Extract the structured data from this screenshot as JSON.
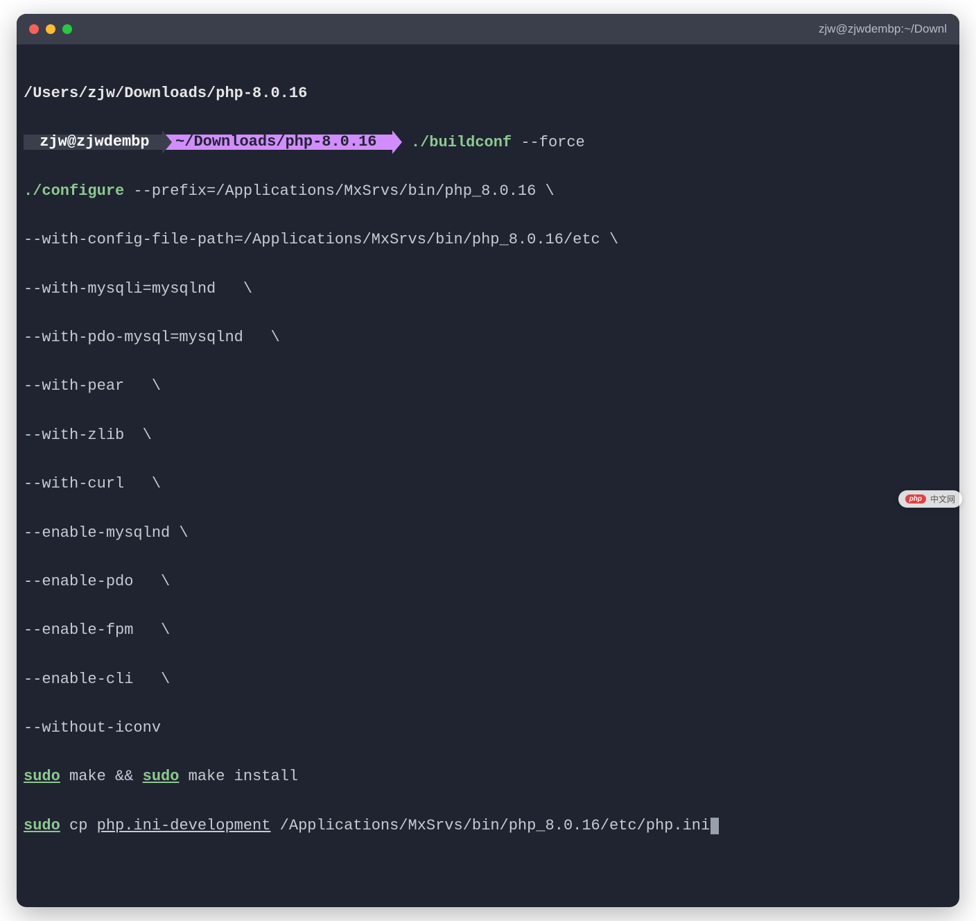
{
  "window": {
    "title": "zjw@zjwdembp:~/Downl"
  },
  "prompt": {
    "user": "zjw@zjwdembp",
    "path": "~/Downloads/php-8.0.16"
  },
  "lines": {
    "pwd": "/Users/zjw/Downloads/php-8.0.16",
    "buildconf_cmd": "./buildconf",
    "buildconf_arg": "--force",
    "configure_cmd": "./configure",
    "configure_l1": " --prefix=/Applications/MxSrvs/bin/php_8.0.16 \\",
    "configure_l2": "--with-config-file-path=/Applications/MxSrvs/bin/php_8.0.16/etc \\",
    "configure_l3": "--with-mysqli=mysqlnd   \\",
    "configure_l4": "--with-pdo-mysql=mysqlnd   \\",
    "configure_l5": "--with-pear   \\",
    "configure_l6": "--with-zlib  \\",
    "configure_l7": "--with-curl   \\",
    "configure_l8": "--enable-mysqlnd \\",
    "configure_l9": "--enable-pdo   \\",
    "configure_l10": "--enable-fpm   \\",
    "configure_l11": "--enable-cli   \\",
    "configure_l12": "--without-iconv",
    "sudo": "sudo",
    "make": "make",
    "amp": " && ",
    "install": " install",
    "cp": "cp ",
    "cp_src": "php.ini-development",
    "cp_dst": " /Applications/MxSrvs/bin/php_8.0.16/etc/php.ini"
  },
  "watermark": {
    "logo": "php",
    "text": "中文网"
  }
}
